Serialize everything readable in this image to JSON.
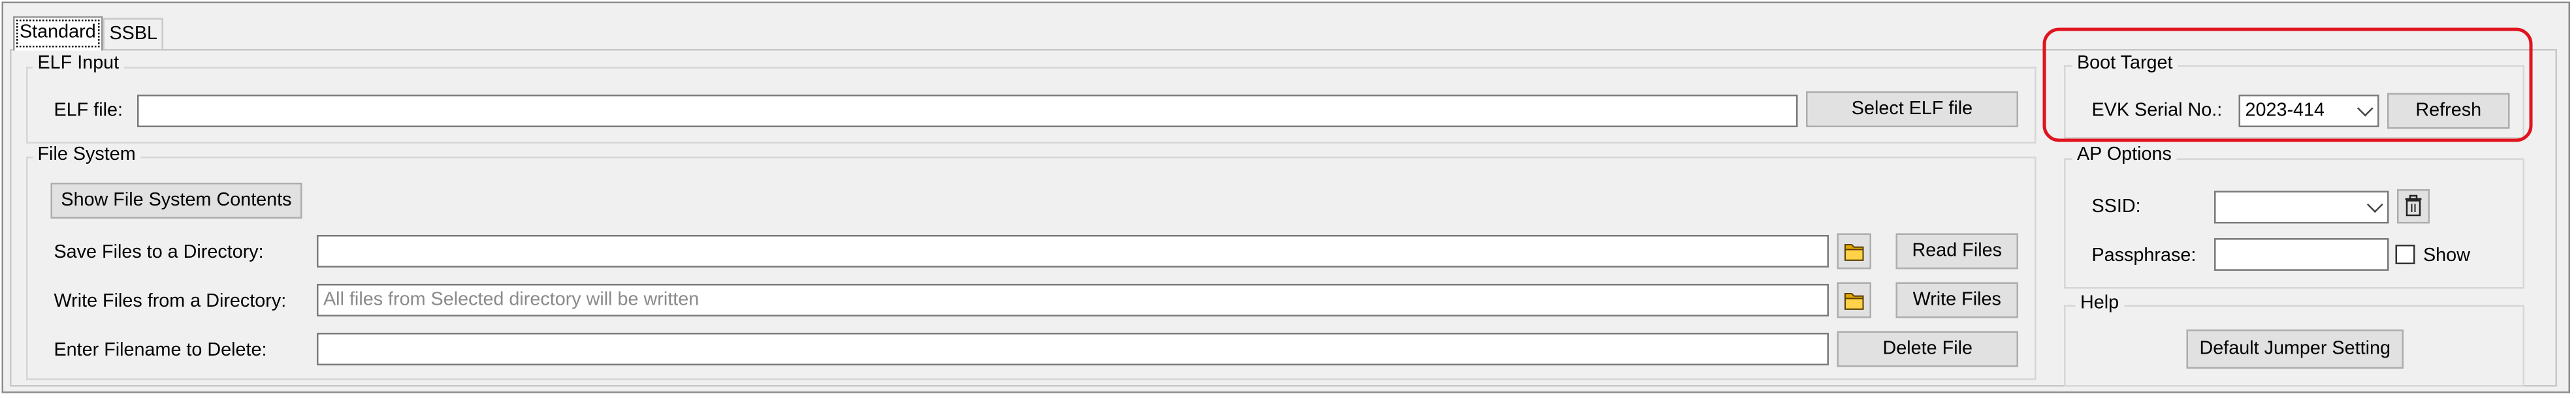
{
  "tabs": [
    {
      "label": "Standard",
      "active": true
    },
    {
      "label": "SSBL",
      "active": false
    }
  ],
  "elf_input": {
    "group_title": "ELF Input",
    "elf_file_label": "ELF file:",
    "elf_file_value": "",
    "select_button": "Select ELF file"
  },
  "file_system": {
    "group_title": "File System",
    "show_contents_button": "Show File System Contents",
    "save_label": "Save Files to a Directory:",
    "save_value": "",
    "read_button": "Read Files",
    "write_label": "Write Files from a Directory:",
    "write_placeholder": "All files from Selected directory will be written",
    "write_button": "Write Files",
    "delete_label": "Enter Filename to Delete:",
    "delete_value": "",
    "delete_button": "Delete File"
  },
  "boot_target": {
    "group_title": "Boot Target",
    "serial_label": "EVK Serial No.:",
    "serial_value": "2023-414",
    "refresh_button": "Refresh"
  },
  "ap_options": {
    "group_title": "AP Options",
    "ssid_label": "SSID:",
    "ssid_value": "",
    "passphrase_label": "Passphrase:",
    "passphrase_value": "",
    "show_label": "Show",
    "show_checked": false
  },
  "help": {
    "group_title": "Help",
    "default_jumper_button": "Default Jumper Setting"
  },
  "colors": {
    "highlight": "#e0141e",
    "window_bg": "#f0f0f0",
    "button_bg": "#e1e1e1"
  }
}
